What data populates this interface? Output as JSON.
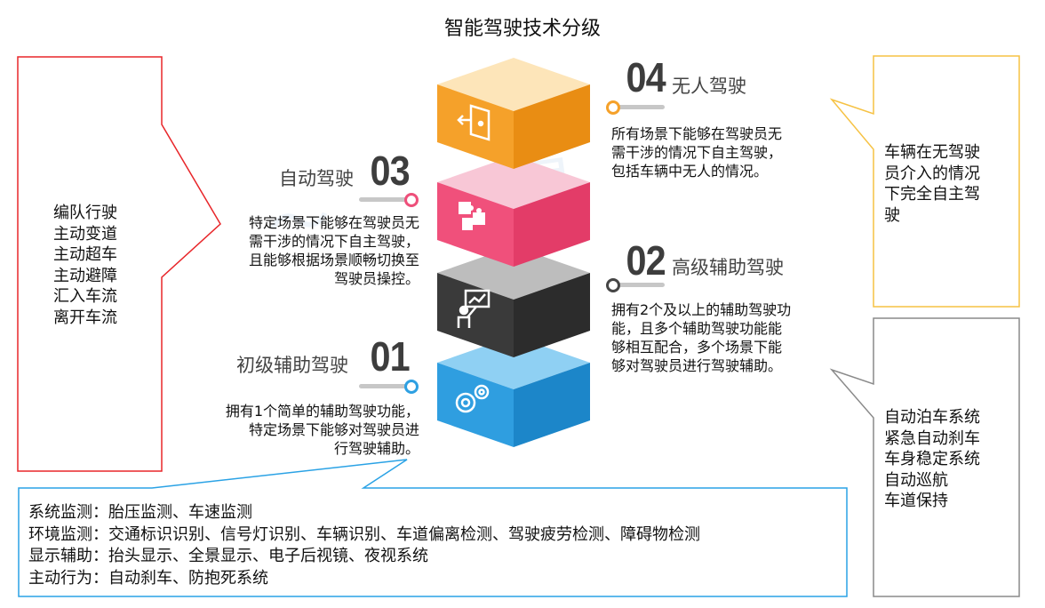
{
  "title": "智能驾驶技术分级",
  "colors": {
    "level4": "#f5a12a",
    "level3": "#ee4f7a",
    "level2": "#454545",
    "level1": "#2ea0e2",
    "red_callout": "#e8262a",
    "yellow_callout": "#f6c244",
    "gray_callout": "#8a8a8a",
    "blue_callout": "#2aa2e5"
  },
  "levels": [
    {
      "num": "04",
      "name": "无人驾驶",
      "desc": "所有场景下能够在驾驶员无\n需干涉的情况下自主驾驶，\n包括车辆中无人的情况。",
      "icon": "exit-icon"
    },
    {
      "num": "03",
      "name": "自动驾驶",
      "desc": "特定场景下能够在驾驶员无\n需干涉的情况下自主驾驶，\n且能够根据场景顺畅切换至\n驾驶员操控。",
      "icon": "puzzle-icon"
    },
    {
      "num": "02",
      "name": "高级辅助驾驶",
      "desc": "拥有2个及以上的辅助驾驶功\n能，且多个辅助驾驶功能能\n够相互配合，多个场景下能\n够对驾驶员进行驾驶辅助。",
      "icon": "presenter-icon"
    },
    {
      "num": "01",
      "name": "初级辅助驾驶",
      "desc": "拥有1个简单的辅助驾驶功能，\n特定场景下能够对驾驶员进\n行驾驶辅助。",
      "icon": "gears-icon"
    }
  ],
  "callouts": {
    "red": [
      "编队行驶",
      "主动变道",
      "主动超车",
      "主动避障",
      "汇入车流",
      "离开车流"
    ],
    "yellow": "车辆在无驾驶\n员介入的情况\n下完全自主驾\n驶",
    "gray": [
      "自动泊车系统",
      "紧急自动刹车",
      "车身稳定系统",
      "自动巡航",
      "车道保持"
    ],
    "blue": [
      "系统监测：胎压监测、车速监测",
      "环境监测：交通标识识别、信号灯识别、车辆识别、车道偏离检测、驾驶疲劳检测、障碍物检测",
      "显示辅助：抬头显示、全景显示、电子后视镜、夜视系统",
      "主动行为：自动刹车、防抱死系统"
    ]
  }
}
